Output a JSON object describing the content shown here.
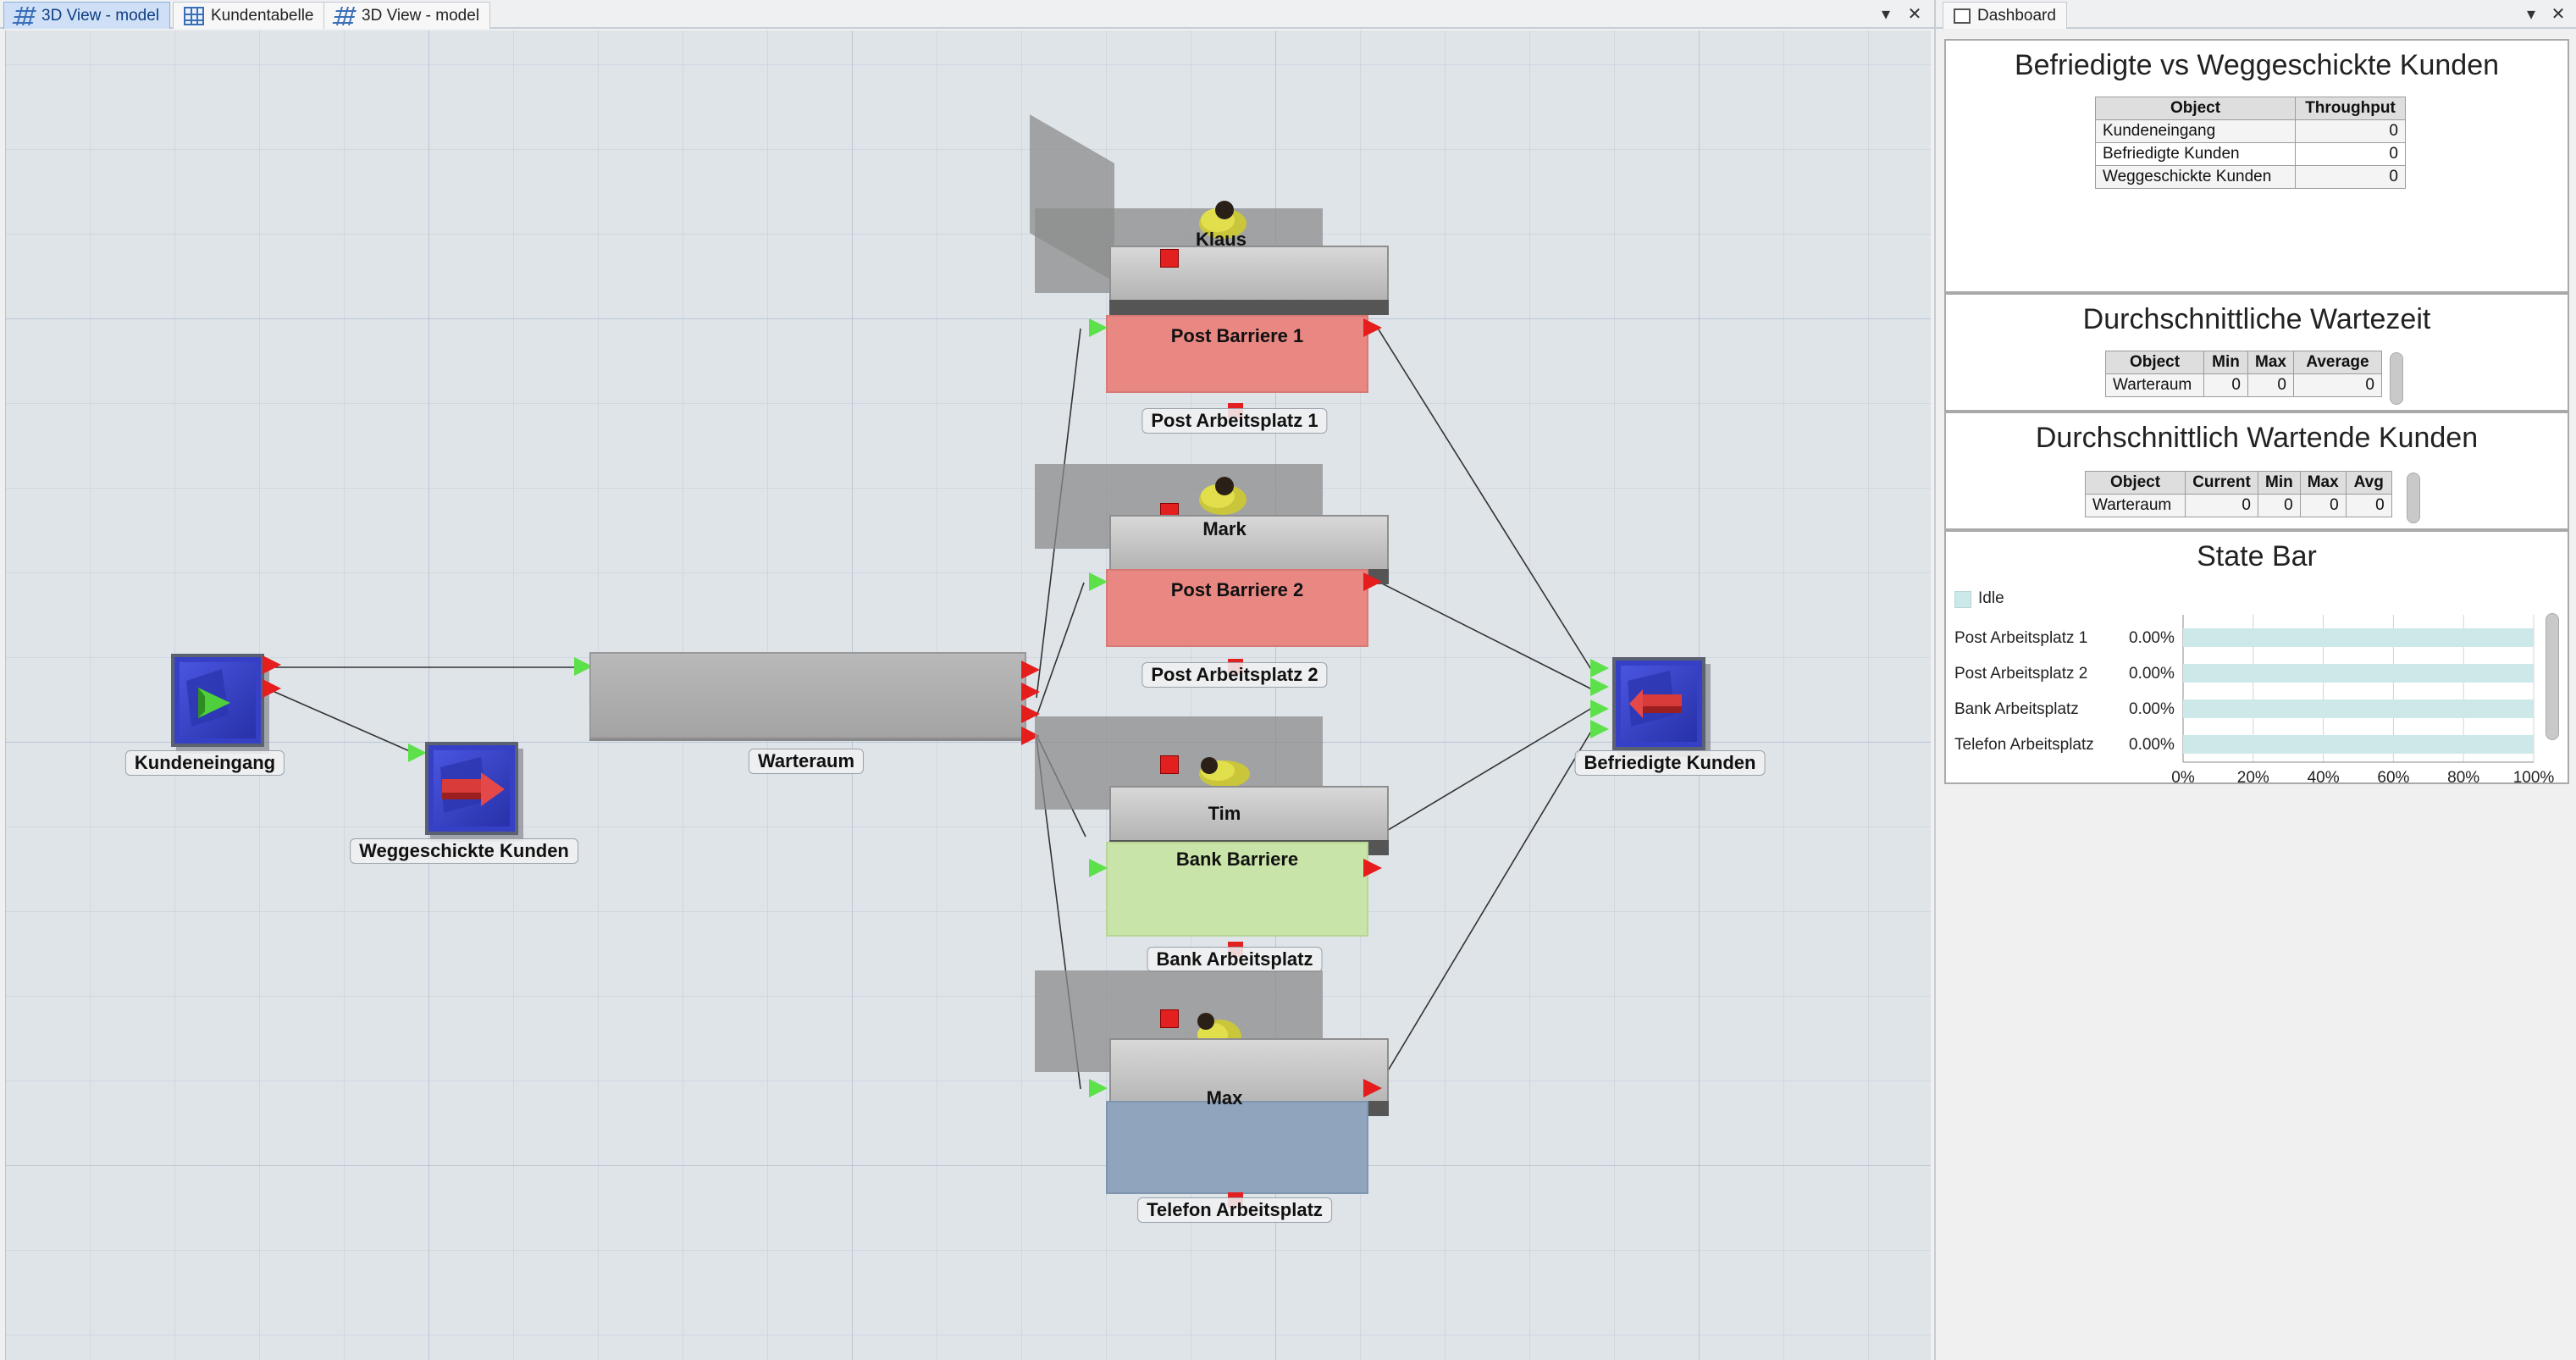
{
  "left_tabs": [
    {
      "label": "3D View - model",
      "icon": "3d-grid-icon",
      "active": true
    },
    {
      "label": "Kundentabelle",
      "icon": "table-icon",
      "active": false
    },
    {
      "label": "3D View - model",
      "icon": "3d-grid-icon",
      "active": false
    }
  ],
  "right_tabs": [
    {
      "label": "Dashboard",
      "icon": "dashboard-icon",
      "active": true
    }
  ],
  "controls": {
    "dropdown": "▾",
    "close": "✕"
  },
  "model": {
    "source_label": "Kundeneingang",
    "rejected_label": "Weggeschickte Kunden",
    "queue_label": "Warteraum",
    "sink_label": "Befriedigte Kunden",
    "stations": [
      {
        "person": "Klaus",
        "barrier": "Post Barriere 1",
        "workplace": "Post Arbeitsplatz 1",
        "color": "#e98782"
      },
      {
        "person": "Mark",
        "barrier": "Post Barriere 2",
        "workplace": "Post Arbeitsplatz 2",
        "color": "#e98782"
      },
      {
        "person": "Tim",
        "barrier": "Bank Barriere",
        "workplace": "Bank Arbeitsplatz",
        "color": "#c9e4a8"
      },
      {
        "person": "Max",
        "barrier": "",
        "workplace": "Telefon Arbeitsplatz",
        "color": "#90a4bd"
      }
    ]
  },
  "dashboard": {
    "throughput": {
      "title": "Befriedigte vs Weggeschickte Kunden",
      "headers": [
        "Object",
        "Throughput"
      ],
      "rows": [
        [
          "Kundeneingang",
          "0"
        ],
        [
          "Befriedigte Kunden",
          "0"
        ],
        [
          "Weggeschickte Kunden",
          "0"
        ]
      ]
    },
    "wait_time": {
      "title": "Durchschnittliche Wartezeit",
      "headers": [
        "Object",
        "Min",
        "Max",
        "Average"
      ],
      "rows": [
        [
          "Warteraum",
          "0",
          "0",
          "0"
        ]
      ]
    },
    "waiting_customers": {
      "title": "Durchschnittlich Wartende Kunden",
      "headers": [
        "Object",
        "Current",
        "Min",
        "Max",
        "Avg"
      ],
      "rows": [
        [
          "Warteraum",
          "0",
          "0",
          "0",
          "0"
        ]
      ]
    },
    "state_bar": {
      "title": "State Bar",
      "legend": [
        "Idle"
      ],
      "colors": {
        "Idle": "#cde8e8"
      }
    }
  },
  "chart_data": {
    "type": "bar",
    "orientation": "horizontal",
    "stacked": true,
    "title": "State Bar",
    "categories": [
      "Post Arbeitsplatz 1",
      "Post Arbeitsplatz 2",
      "Bank Arbeitsplatz",
      "Telefon Arbeitsplatz"
    ],
    "series": [
      {
        "name": "Idle",
        "values": [
          100,
          100,
          100,
          100
        ]
      }
    ],
    "value_labels": [
      "0.00%",
      "0.00%",
      "0.00%",
      "0.00%"
    ],
    "xticks": [
      "0%",
      "20%",
      "40%",
      "60%",
      "80%",
      "100%"
    ],
    "xlim": [
      0,
      100
    ],
    "legend_position": "top-left",
    "grid": true
  }
}
